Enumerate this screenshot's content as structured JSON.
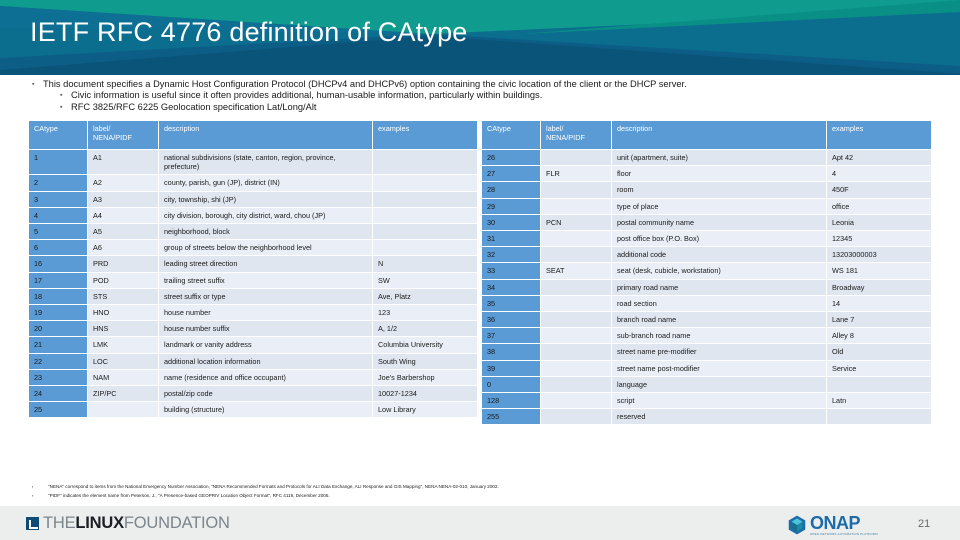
{
  "header": {
    "title": "IETF RFC 4776 definition of CAtype",
    "bg_color": "#0b6e8f",
    "accent_teal": "#0f9b8e",
    "accent_dark_blue": "#0d5c86"
  },
  "bullets": [
    {
      "level": 1,
      "text": "This document specifies a Dynamic Host Configuration Protocol (DHCPv4 and DHCPv6) option containing the civic location of the client or the  DHCP server."
    },
    {
      "level": 2,
      "text": "Civic information is useful since it often provides additional, human-usable information, particularly within buildings."
    },
    {
      "level": 2,
      "text": "RFC 3825/RFC 6225 Geolocation specification Lat/Long/Alt"
    }
  ],
  "table": {
    "headers": [
      "CAtype",
      "label/\nNENA/PIDF",
      "description",
      "examples"
    ],
    "header_catype": "CAtype",
    "header_label_l1": "label/",
    "header_label_l2": "NENA/PIDF",
    "header_description": "description",
    "header_examples": "examples",
    "catype_cell_color": "#5b9bd5",
    "row_color_a": "#dfe6f0",
    "row_color_b": "#eaeef6"
  },
  "left_rows": [
    {
      "catype": "1",
      "label": "A1",
      "description": "national subdivisions (state, canton, region, province, prefecture)",
      "examples": ""
    },
    {
      "catype": "2",
      "label": "A2",
      "description": "county, parish, gun (JP), district (IN)",
      "examples": ""
    },
    {
      "catype": "3",
      "label": "A3",
      "description": "city, township, shi (JP)",
      "examples": ""
    },
    {
      "catype": "4",
      "label": "A4",
      "description": "city division, borough, city district, ward, chou (JP)",
      "examples": ""
    },
    {
      "catype": "5",
      "label": "A5",
      "description": "neighborhood, block",
      "examples": ""
    },
    {
      "catype": "6",
      "label": "A6",
      "description": "group of streets below the neighborhood level",
      "examples": ""
    },
    {
      "catype": "16",
      "label": "PRD",
      "description": "leading street direction",
      "examples": "N"
    },
    {
      "catype": "17",
      "label": "POD",
      "description": "trailing street suffix",
      "examples": "SW"
    },
    {
      "catype": "18",
      "label": "STS",
      "description": "street suffix or type",
      "examples": "Ave, Platz"
    },
    {
      "catype": "19",
      "label": "HNO",
      "description": "house number",
      "examples": "123"
    },
    {
      "catype": "20",
      "label": "HNS",
      "description": "house number suffix",
      "examples": "A, 1/2"
    },
    {
      "catype": "21",
      "label": "LMK",
      "description": "landmark or vanity address",
      "examples": "Columbia University"
    },
    {
      "catype": "22",
      "label": "LOC",
      "description": "additional location information",
      "examples": "South Wing"
    },
    {
      "catype": "23",
      "label": "NAM",
      "description": "name (residence and office occupant)",
      "examples": "Joe's Barbershop"
    },
    {
      "catype": "24",
      "label": "ZIP/PC",
      "description": "postal/zip code",
      "examples": "10027-1234"
    },
    {
      "catype": "25",
      "label": "",
      "description": "building (structure)",
      "examples": "Low Library"
    }
  ],
  "right_rows": [
    {
      "catype": "26",
      "label": "",
      "description": "unit (apartment, suite)",
      "examples": "Apt 42"
    },
    {
      "catype": "27",
      "label": "FLR",
      "description": "floor",
      "examples": "4"
    },
    {
      "catype": "28",
      "label": "",
      "description": "room",
      "examples": "450F"
    },
    {
      "catype": "29",
      "label": "",
      "description": "type of place",
      "examples": "office"
    },
    {
      "catype": "30",
      "label": "PCN",
      "description": "postal community name",
      "examples": "Leonia"
    },
    {
      "catype": "31",
      "label": "",
      "description": "post office box (P.O. Box)",
      "examples": "12345"
    },
    {
      "catype": "32",
      "label": "",
      "description": "additional code",
      "examples": "13203000003"
    },
    {
      "catype": "33",
      "label": "SEAT",
      "description": "seat (desk, cubicle, workstation)",
      "examples": "WS 181"
    },
    {
      "catype": "34",
      "label": "",
      "description": "primary road name",
      "examples": "Broadway"
    },
    {
      "catype": "35",
      "label": "",
      "description": "road section",
      "examples": "14"
    },
    {
      "catype": "36",
      "label": "",
      "description": "branch road name",
      "examples": "Lane 7"
    },
    {
      "catype": "37",
      "label": "",
      "description": "sub-branch road name",
      "examples": "Alley 8"
    },
    {
      "catype": "38",
      "label": "",
      "description": "street name pre-modifier",
      "examples": "Old"
    },
    {
      "catype": "39",
      "label": "",
      "description": "street name post-modifier",
      "examples": "Service"
    },
    {
      "catype": "0",
      "label": "",
      "description": "language",
      "examples": ""
    },
    {
      "catype": "128",
      "label": "",
      "description": "script",
      "examples": "Latn"
    },
    {
      "catype": "255",
      "label": "",
      "description": "reserved",
      "examples": ""
    }
  ],
  "footnotes": [
    "\"NENA\" correspond to items from the National Emergency Number Association, \"NENA Recommended Formats and Protocols for ALI Data Exchange, ALI Response and GIS Mapping\", NENA NENA-02-010, January 2002.",
    "\"PIDF\" indicates the element name from Peterson, J., \"A Presence-based GEOPRIV Location Object Format\", RFC 4119, December 2005."
  ],
  "footer": {
    "linux_foundation": {
      "word_the": "THE",
      "word_linux": "LINUX",
      "word_foundation": "FOUNDATION"
    },
    "onap": {
      "word": "ONAP",
      "tagline": "OPEN NETWORK AUTOMATION PLATFORM"
    },
    "page_number": "21"
  }
}
